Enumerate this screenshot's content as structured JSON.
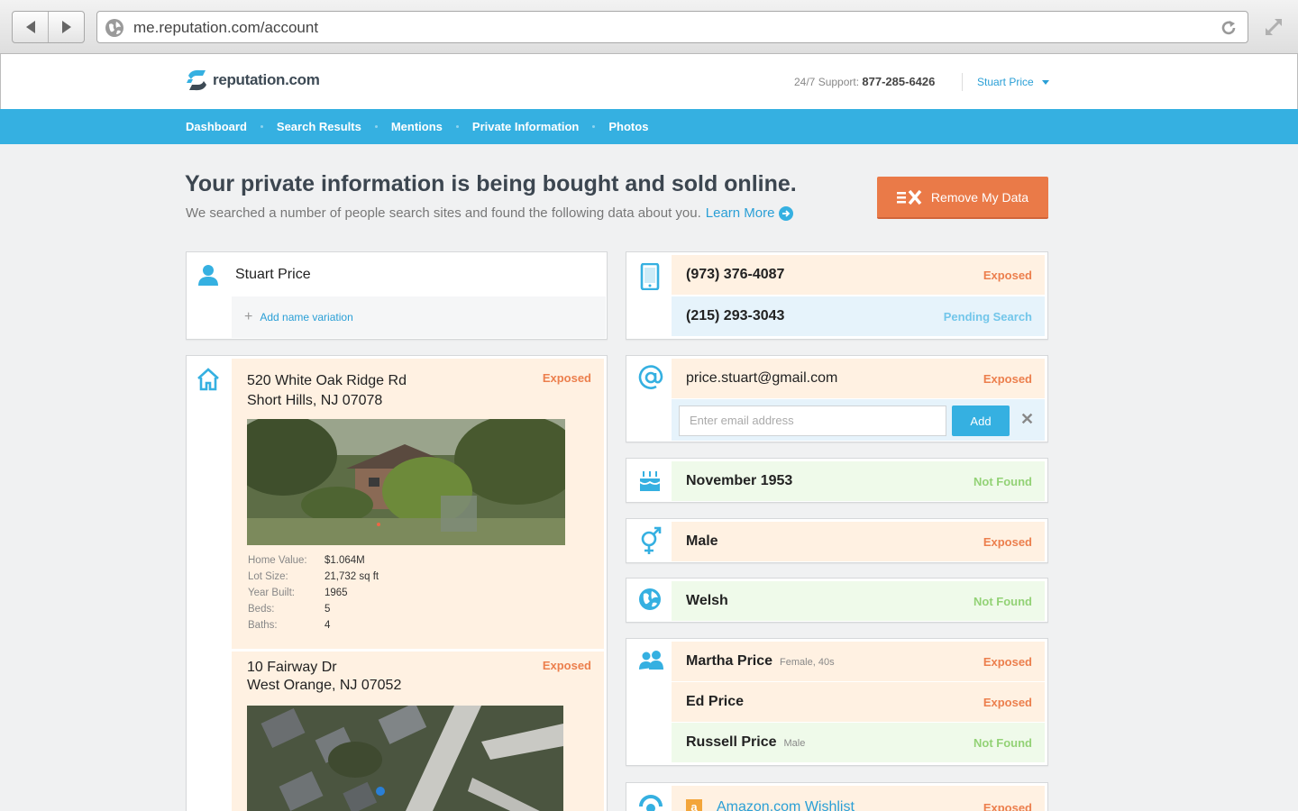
{
  "browser": {
    "url": "me.reputation.com/account"
  },
  "header": {
    "logo_text": "reputation.com",
    "support_label": "24/7 Support:",
    "support_phone": "877-285-6426",
    "user_name": "Stuart Price"
  },
  "nav": [
    "Dashboard",
    "Search Results",
    "Mentions",
    "Private Information",
    "Photos"
  ],
  "hero": {
    "title": "Your private information is being bought and sold online.",
    "subtitle": "We searched a number of people search sites and found the following data about you.",
    "learn_more": "Learn More",
    "remove_button": "Remove My Data"
  },
  "name_card": {
    "name": "Stuart Price",
    "add_variation": "Add name variation"
  },
  "addresses": [
    {
      "line1": "520 White Oak Ridge Rd",
      "line2": "Short Hills, NJ 07078",
      "status": "Exposed",
      "details": [
        {
          "label": "Home Value:",
          "value": "$1.064M"
        },
        {
          "label": "Lot Size:",
          "value": "21,732 sq ft"
        },
        {
          "label": "Year Built:",
          "value": "1965"
        },
        {
          "label": "Beds:",
          "value": "5"
        },
        {
          "label": "Baths:",
          "value": "4"
        }
      ]
    },
    {
      "line1": "10 Fairway Dr",
      "line2": "West Orange, NJ 07052",
      "status": "Exposed"
    }
  ],
  "phones": [
    {
      "value": "(973) 376-4087",
      "status": "Exposed"
    },
    {
      "value": "(215) 293-3043",
      "status": "Pending Search"
    }
  ],
  "email": {
    "value": "price.stuart@gmail.com",
    "status": "Exposed",
    "placeholder": "Enter email address",
    "add_label": "Add",
    "close": "✕"
  },
  "birthday": {
    "value": "November 1953",
    "status": "Not Found"
  },
  "gender": {
    "value": "Male",
    "status": "Exposed"
  },
  "ethnicity": {
    "value": "Welsh",
    "status": "Not Found"
  },
  "relatives": [
    {
      "name": "Martha Price",
      "meta": "Female, 40s",
      "status": "Exposed"
    },
    {
      "name": "Ed Price",
      "meta": "",
      "status": "Exposed"
    },
    {
      "name": "Russell Price",
      "meta": "Male",
      "status": "Not Found"
    }
  ],
  "wishlist": {
    "value": "Amazon.com Wishlist",
    "status": "Exposed"
  },
  "colors": {
    "accent": "#35b0e1",
    "exposed": "#ec7f4d",
    "pending": "#72c6ea",
    "not_found": "#93d276",
    "remove": "#ea7a48"
  }
}
